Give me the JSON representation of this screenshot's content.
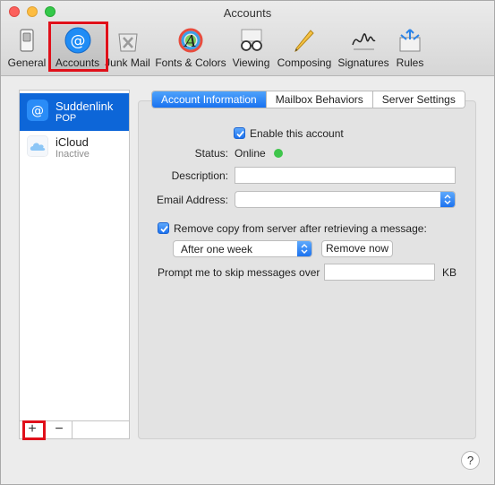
{
  "window": {
    "title": "Accounts"
  },
  "toolbar": {
    "items": [
      {
        "label": "General",
        "icon": "general-switch-icon"
      },
      {
        "label": "Accounts",
        "icon": "at-sign-icon"
      },
      {
        "label": "Junk Mail",
        "icon": "junk-mail-icon"
      },
      {
        "label": "Fonts & Colors",
        "icon": "fonts-colors-icon"
      },
      {
        "label": "Viewing",
        "icon": "glasses-icon"
      },
      {
        "label": "Composing",
        "icon": "pencil-icon"
      },
      {
        "label": "Signatures",
        "icon": "signature-icon"
      },
      {
        "label": "Rules",
        "icon": "rules-icon"
      }
    ],
    "selected": "Accounts"
  },
  "sidebar": {
    "accounts": [
      {
        "name": "Suddenlink",
        "subtitle": "POP",
        "icon": "at-sign-icon",
        "selected": true
      },
      {
        "name": "iCloud",
        "subtitle": "Inactive",
        "icon": "cloud-icon",
        "selected": false
      }
    ],
    "add_symbol": "+",
    "remove_symbol": "−"
  },
  "tabs": [
    {
      "label": "Account Information",
      "active": true
    },
    {
      "label": "Mailbox Behaviors",
      "active": false
    },
    {
      "label": "Server Settings",
      "active": false
    }
  ],
  "form": {
    "enable_label": "Enable this account",
    "enable_checked": true,
    "status_label": "Status:",
    "status_value": "Online",
    "description_label": "Description:",
    "description_value": "",
    "email_label": "Email Address:",
    "email_value": "",
    "remove_copy_label": "Remove copy from server after retrieving a message:",
    "remove_copy_checked": true,
    "remove_after_value": "After one week",
    "remove_now_label": "Remove now",
    "skip_label": "Prompt me to skip messages over",
    "skip_value": "",
    "skip_unit": "KB"
  },
  "help": {
    "symbol": "?"
  },
  "colors": {
    "accent": "#1a72f0",
    "selection": "#0d66d8",
    "online": "#3fc54b",
    "highlight_outline": "#e0101a"
  }
}
